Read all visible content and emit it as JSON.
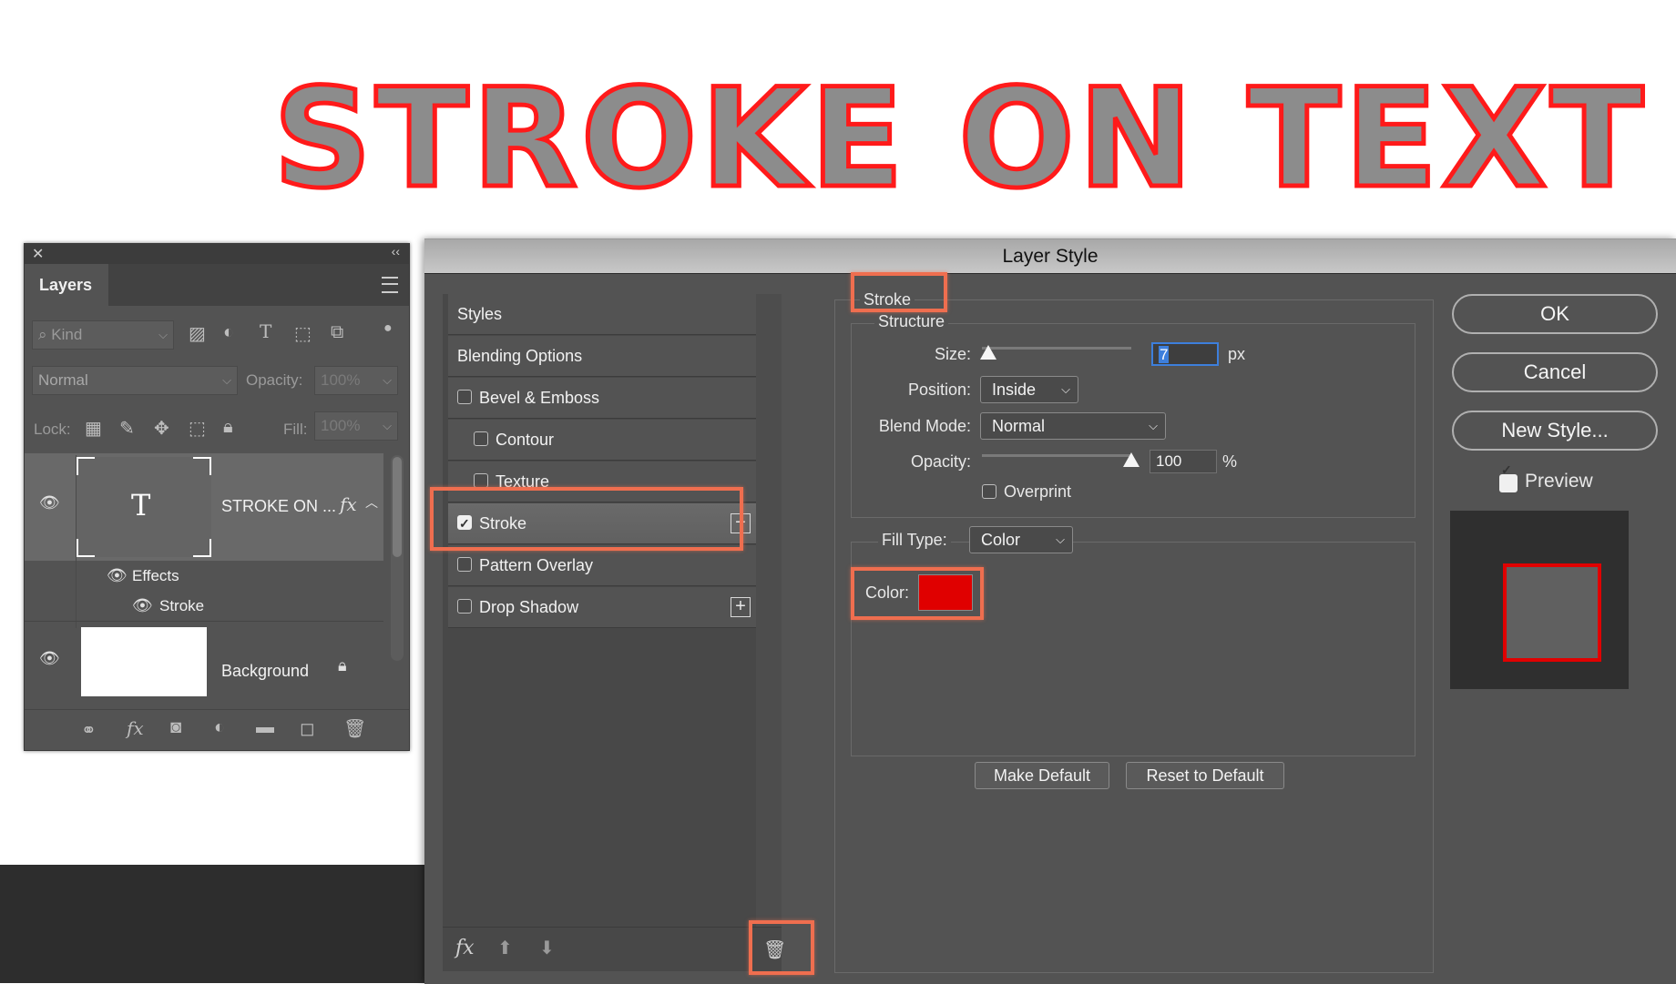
{
  "headline": "STROKE ON TEXT",
  "colors": {
    "accent_red": "#e00000",
    "highlight": "#ef6e4f",
    "panel_bg": "#535353"
  },
  "layers_panel": {
    "tab": "Layers",
    "kind_label": "Kind",
    "blend_mode": "Normal",
    "opacity_label": "Opacity:",
    "opacity_value": "100%",
    "lock_label": "Lock:",
    "fill_label": "Fill:",
    "fill_value": "100%",
    "layers": [
      {
        "name": "STROKE ON ...",
        "fx": "fx",
        "effects_label": "Effects",
        "effect": "Stroke"
      },
      {
        "name": "Background"
      }
    ]
  },
  "dialog": {
    "title": "Layer Style",
    "styles": [
      {
        "label": "Styles"
      },
      {
        "label": "Blending Options"
      },
      {
        "label": "Bevel & Emboss",
        "checked": false
      },
      {
        "label": "Contour",
        "checked": false
      },
      {
        "label": "Texture",
        "checked": false
      },
      {
        "label": "Stroke",
        "checked": true
      },
      {
        "label": "Pattern Overlay",
        "checked": false
      },
      {
        "label": "Drop Shadow",
        "checked": false
      }
    ],
    "fx_label": "fx",
    "section_title": "Stroke",
    "structure": {
      "legend": "Structure",
      "size_label": "Size:",
      "size_value": "7",
      "size_unit": "px",
      "size_slider_fraction": 0.04,
      "position_label": "Position:",
      "position_value": "Inside",
      "blend_mode_label": "Blend Mode:",
      "blend_mode_value": "Normal",
      "opacity_label": "Opacity:",
      "opacity_value": "100",
      "opacity_unit": "%",
      "opacity_slider_fraction": 1.0,
      "overprint_label": "Overprint"
    },
    "fill_type_label": "Fill Type:",
    "fill_type_value": "Color",
    "color_label": "Color:",
    "color_value": "#e00000",
    "make_default": "Make Default",
    "reset_default": "Reset to Default",
    "ok": "OK",
    "cancel": "Cancel",
    "new_style": "New Style...",
    "preview_label": "Preview",
    "preview_checked": true
  }
}
